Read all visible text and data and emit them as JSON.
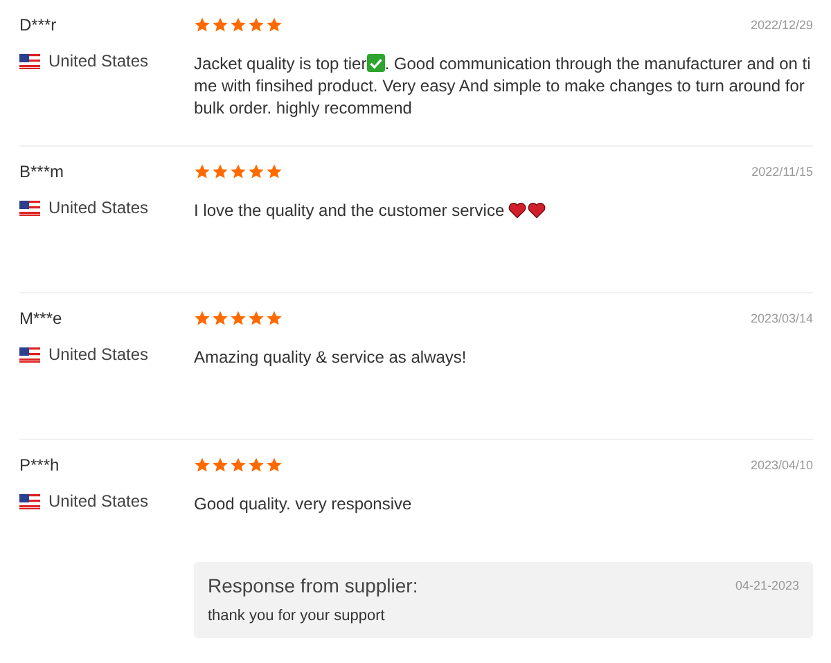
{
  "reviews": [
    {
      "name": "D***r",
      "country": "United States",
      "stars": 5,
      "date": "2022/12/29",
      "body": [
        {
          "kind": "text",
          "text": "Jacket quality is top tier"
        },
        {
          "kind": "check"
        },
        {
          "kind": "text",
          "text": ". Good communication through the manufacturer and on time with finsihed product. Very easy And simple to make changes to turn around for bulk order. highly recommend"
        }
      ]
    },
    {
      "name": "B***m",
      "country": "United States",
      "stars": 5,
      "date": "2022/11/15",
      "body": [
        {
          "kind": "text",
          "text": "I love the quality and the customer service "
        },
        {
          "kind": "heart"
        },
        {
          "kind": "heart"
        }
      ]
    },
    {
      "name": "M***e",
      "country": "United States",
      "stars": 5,
      "date": "2023/03/14",
      "body": [
        {
          "kind": "text",
          "text": "Amazing quality & service as always!"
        }
      ]
    },
    {
      "name": "P***h",
      "country": "United States",
      "stars": 5,
      "date": "2023/04/10",
      "body": [
        {
          "kind": "text",
          "text": "Good quality. very responsive"
        }
      ],
      "response": {
        "title": "Response from supplier:",
        "date": "04-21-2023",
        "text": "thank you for your support"
      }
    }
  ]
}
